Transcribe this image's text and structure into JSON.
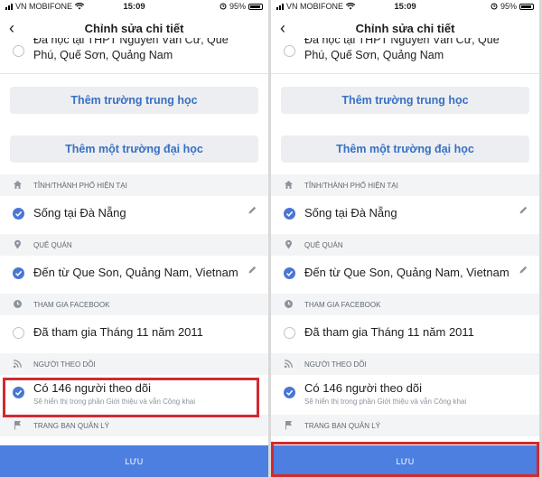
{
  "panels": [
    {
      "status": {
        "carrier": "VN MOBIFONE",
        "time": "15:09",
        "battery": "95%"
      },
      "header": {
        "title": "Chỉnh sửa chi tiết"
      },
      "school": {
        "line_top": "Đa học tại THPT Nguyễn Văn Cừ, Quế",
        "line_bottom": "Phú, Quế Sơn, Quảng Nam"
      },
      "add_high_school": "Thêm trường trung học",
      "add_university": "Thêm một trường đại học",
      "current_city": {
        "header": "TỈNH/THÀNH PHỐ HIỆN TẠI",
        "value": "Sống tại Đà Nẵng"
      },
      "hometown": {
        "header": "QUÊ QUÁN",
        "value": "Đến từ Que Son, Quảng Nam, Vietnam"
      },
      "joined": {
        "header": "THAM GIA FACEBOOK",
        "value": "Đã tham gia Tháng 11 năm 2011"
      },
      "followers": {
        "header": "NGƯỜI THEO DÕI",
        "value": "Có 146 người theo dõi",
        "note": "Sẽ hiển thị trong phần Giới thiệu và vẫn Công khai"
      },
      "managed_pages": {
        "header": "TRANG BẠN QUẢN LÝ"
      },
      "save_label": "LƯU",
      "highlight": "followers"
    },
    {
      "status": {
        "carrier": "VN MOBIFONE",
        "time": "15:09",
        "battery": "95%"
      },
      "header": {
        "title": "Chỉnh sửa chi tiết"
      },
      "school": {
        "line_top": "Đa học tại THPT Nguyễn Văn Cừ, Quế",
        "line_bottom": "Phú, Quế Sơn, Quảng Nam"
      },
      "add_high_school": "Thêm trường trung học",
      "add_university": "Thêm một trường đại học",
      "current_city": {
        "header": "TỈNH/THÀNH PHỐ HIỆN TẠI",
        "value": "Sống tại Đà Nẵng"
      },
      "hometown": {
        "header": "QUÊ QUÁN",
        "value": "Đến từ Que Son, Quảng Nam, Vietnam"
      },
      "joined": {
        "header": "THAM GIA FACEBOOK",
        "value": "Đã tham gia Tháng 11 năm 2011"
      },
      "followers": {
        "header": "NGƯỜI THEO DÕI",
        "value": "Có 146 người theo dõi",
        "note": "Sẽ hiển thị trong phần Giới thiệu và vẫn Công khai"
      },
      "managed_pages": {
        "header": "TRANG BẠN QUẢN LÝ"
      },
      "save_label": "LƯU",
      "highlight": "save-button"
    }
  ],
  "colors": {
    "accent": "#4c7fe0",
    "button_text": "#3770c4",
    "highlight": "#d12a2f",
    "check": "#4a76d4"
  },
  "icons": [
    "wifi-icon",
    "signal-icon",
    "battery-icon",
    "back-arrow-icon",
    "home-icon",
    "location-pin-icon",
    "clock-icon",
    "rss-icon",
    "flag-icon",
    "pencil-icon",
    "checkmark-icon"
  ]
}
